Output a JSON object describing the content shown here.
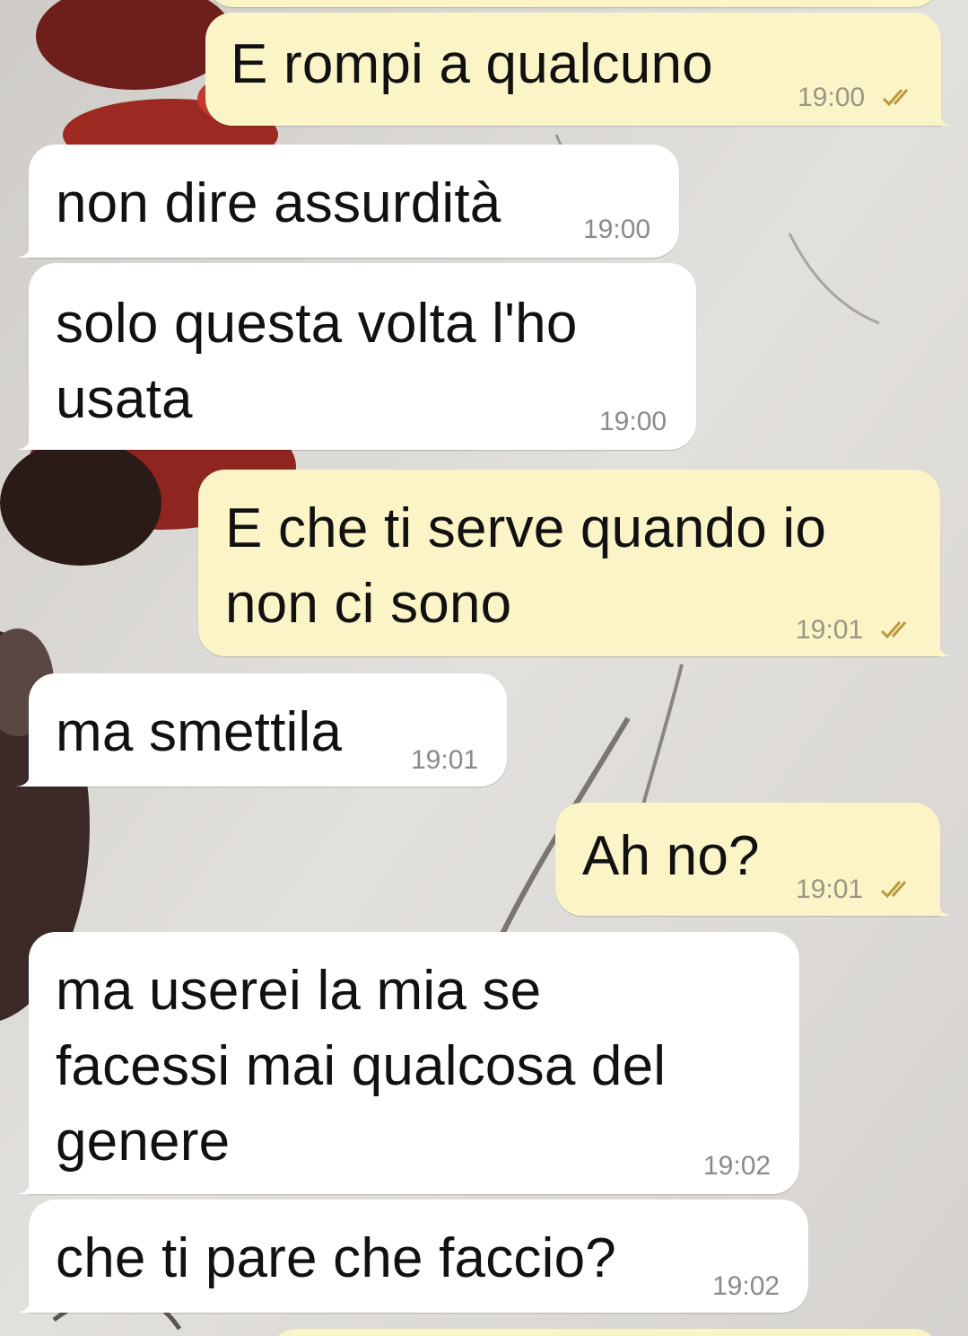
{
  "colors": {
    "incoming_bubble": "#ffffff",
    "outgoing_bubble": "#fbf4c6",
    "timestamp": "#8a8a8a",
    "read_ticks": "#b89a3e"
  },
  "icons": {
    "read_receipt": "double-check-icon"
  },
  "messages": [
    {
      "direction": "out",
      "text": "E rompi a qualcuno",
      "time": "19:00",
      "status": "read"
    },
    {
      "direction": "in",
      "text": "non dire assurdità",
      "time": "19:00"
    },
    {
      "direction": "in",
      "text": "solo questa volta l'ho\nusata",
      "time": "19:00"
    },
    {
      "direction": "out",
      "text": "E che ti serve quando io\nnon ci sono",
      "time": "19:01",
      "status": "read"
    },
    {
      "direction": "in",
      "text": "ma smettila",
      "time": "19:01"
    },
    {
      "direction": "out",
      "text": "Ah no?",
      "time": "19:01",
      "status": "read"
    },
    {
      "direction": "in",
      "text": "ma userei la mia se\nfacessi mai qualcosa del\ngenere",
      "time": "19:02"
    },
    {
      "direction": "in",
      "text": "che ti pare che faccio?",
      "time": "19:02"
    }
  ]
}
